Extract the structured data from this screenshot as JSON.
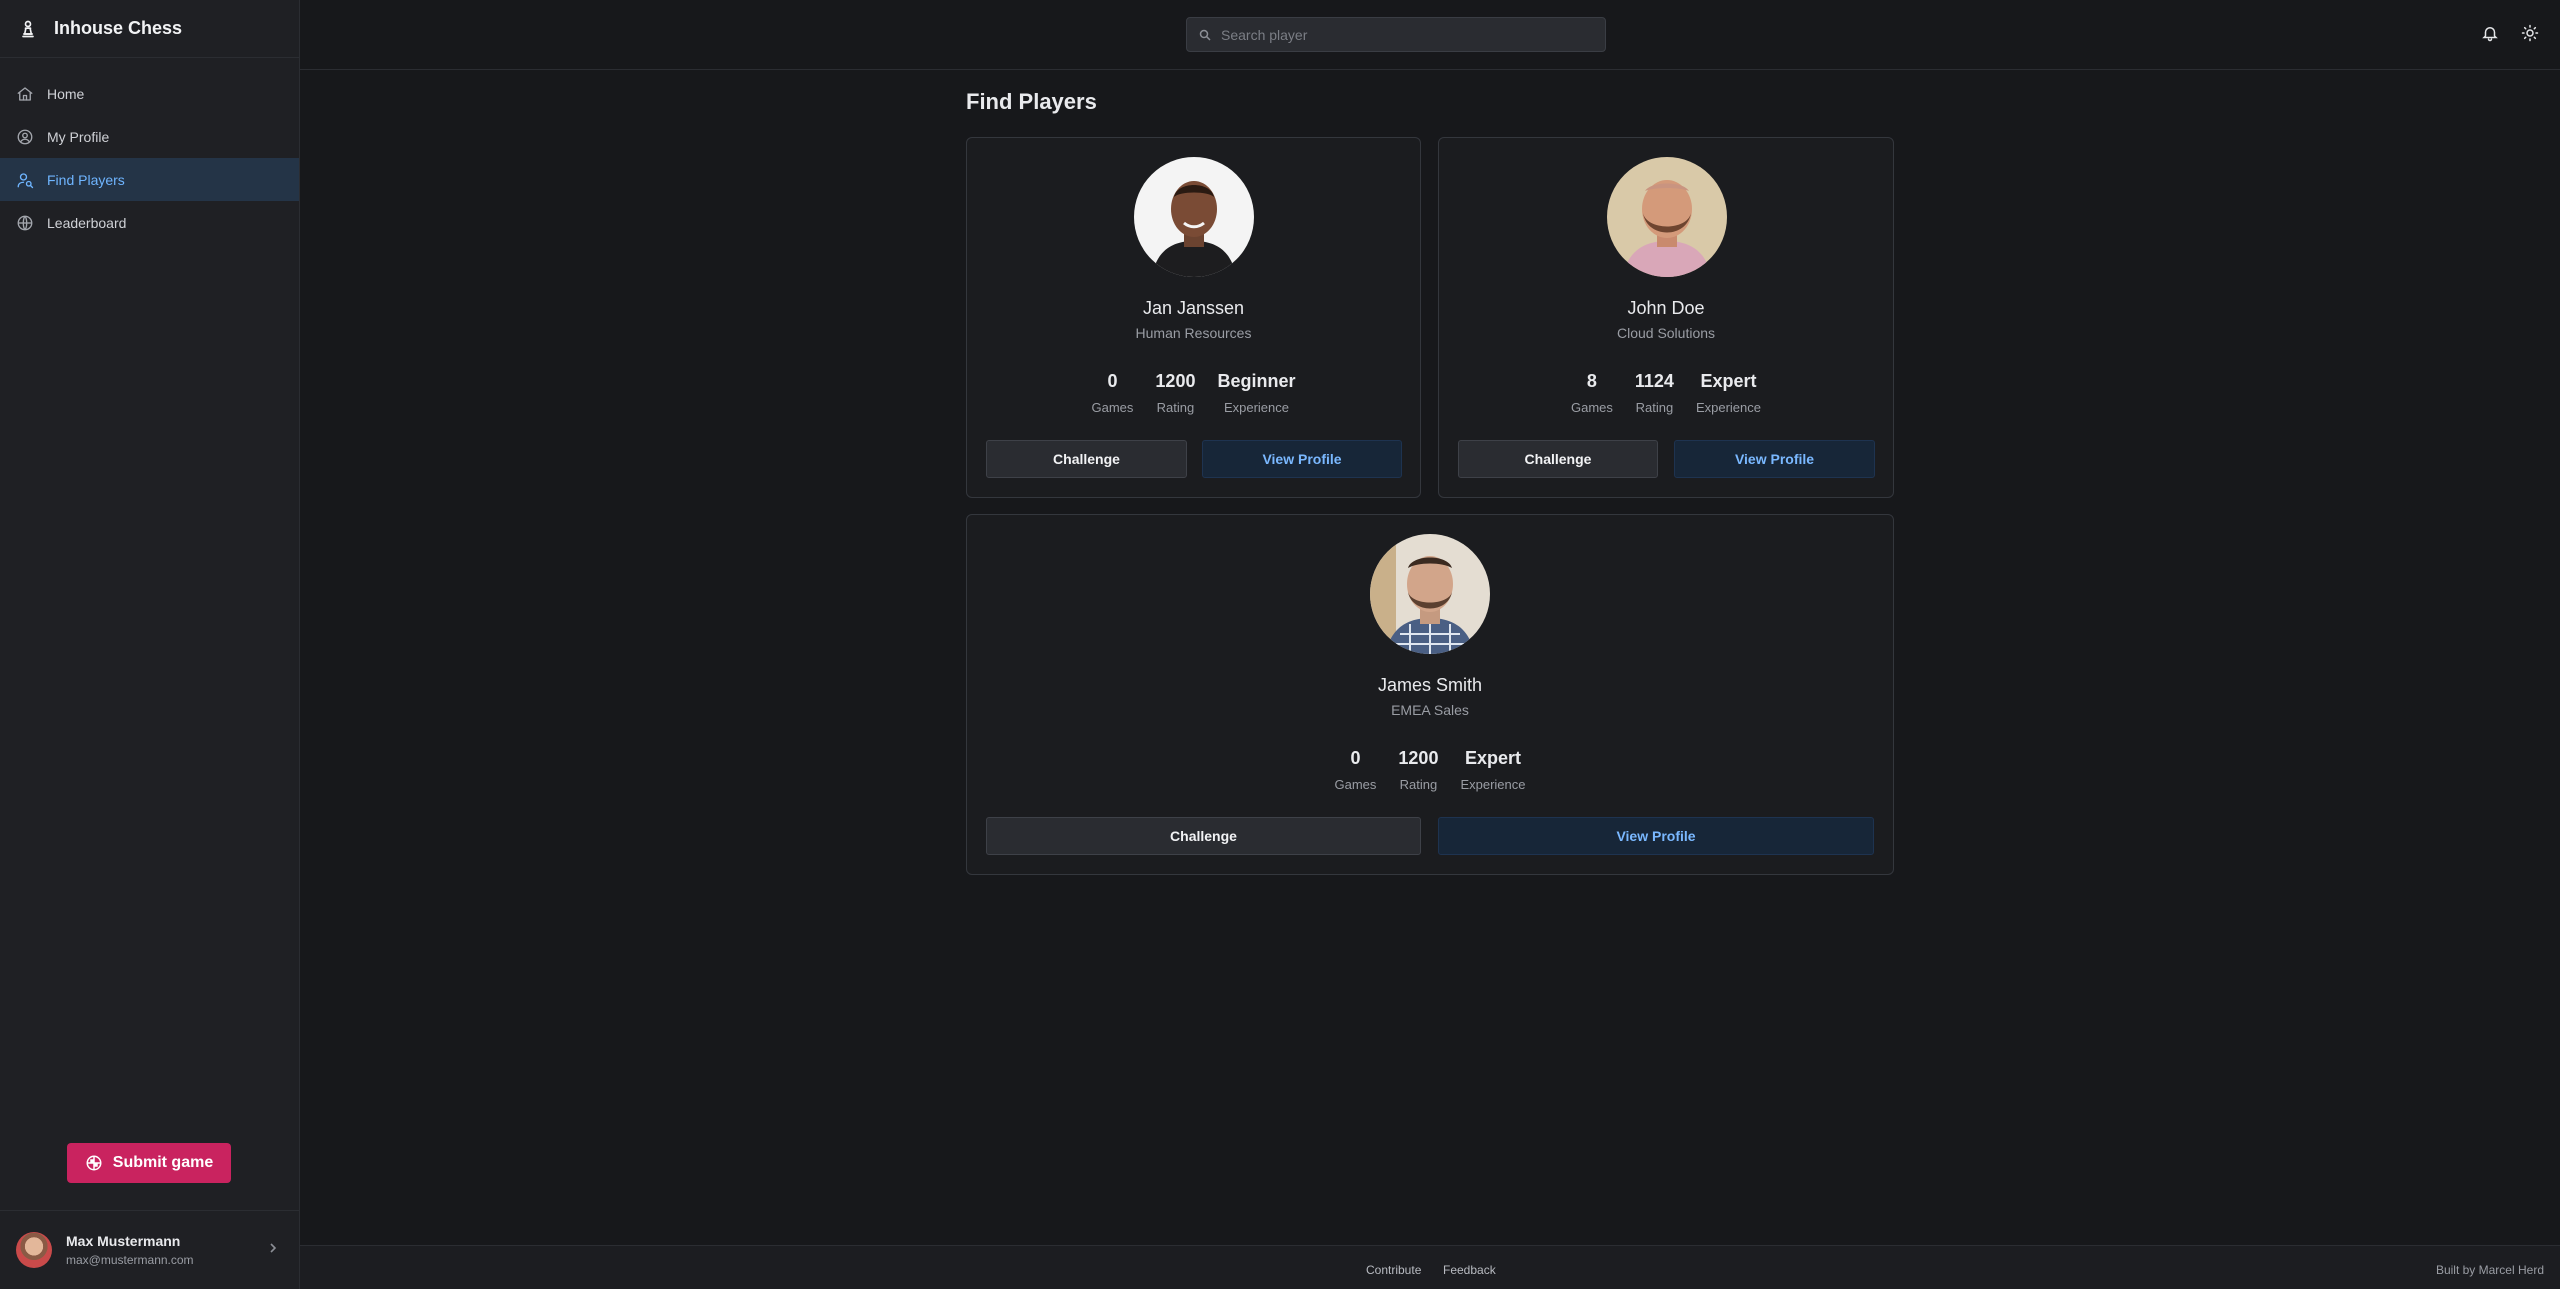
{
  "app": {
    "title": "Inhouse Chess"
  },
  "sidebar": {
    "items": [
      {
        "label": "Home",
        "icon": "home-icon"
      },
      {
        "label": "My Profile",
        "icon": "user-circle-icon"
      },
      {
        "label": "Find Players",
        "icon": "user-search-icon"
      },
      {
        "label": "Leaderboard",
        "icon": "globe-icon"
      }
    ],
    "submit_label": "Submit game",
    "user": {
      "name": "Max Mustermann",
      "email": "max@mustermann.com"
    }
  },
  "header": {
    "search_placeholder": "Search player"
  },
  "main": {
    "title": "Find Players",
    "stat_labels": {
      "games": "Games",
      "rating": "Rating",
      "experience": "Experience"
    },
    "challenge_label": "Challenge",
    "view_label": "View Profile",
    "players": [
      {
        "name": "Jan Janssen",
        "department": "Human Resources",
        "games": "0",
        "rating": "1200",
        "experience": "Beginner"
      },
      {
        "name": "John Doe",
        "department": "Cloud Solutions",
        "games": "8",
        "rating": "1124",
        "experience": "Expert"
      },
      {
        "name": "James Smith",
        "department": "EMEA Sales",
        "games": "0",
        "rating": "1200",
        "experience": "Expert"
      }
    ]
  },
  "footer": {
    "contribute": "Contribute",
    "feedback": "Feedback",
    "credit": "Built by Marcel Herd"
  }
}
